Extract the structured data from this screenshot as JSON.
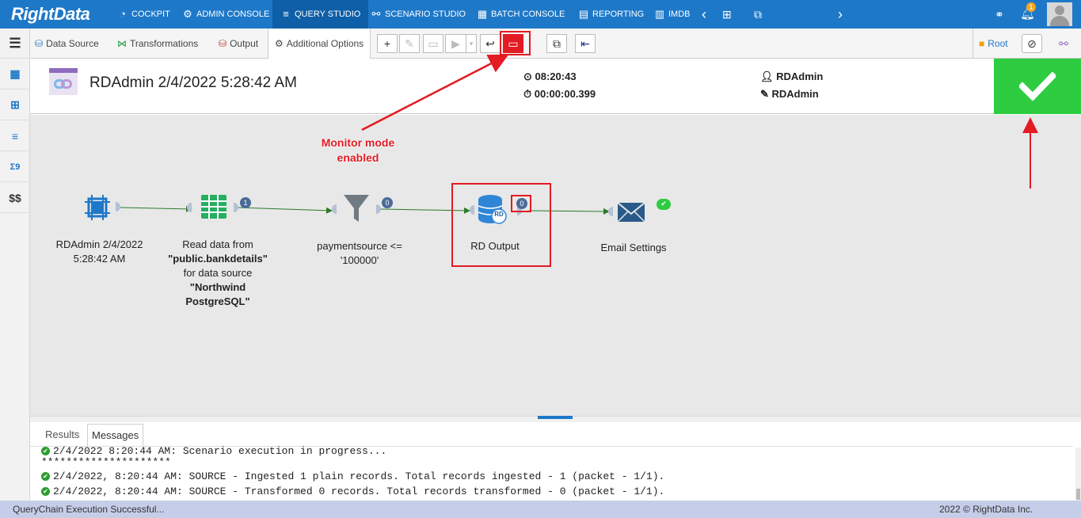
{
  "app": {
    "logo": "RightData"
  },
  "nav": {
    "items": [
      {
        "label": "COCKPIT",
        "icon": "cockpit-icon"
      },
      {
        "label": "ADMIN CONSOLE",
        "icon": "gear-icon"
      },
      {
        "label": "QUERY STUDIO",
        "icon": "database-icon"
      },
      {
        "label": "SCENARIO STUDIO",
        "icon": "scenario-icon"
      },
      {
        "label": "BATCH CONSOLE",
        "icon": "batch-icon"
      },
      {
        "label": "REPORTING",
        "icon": "report-icon"
      },
      {
        "label": "IMDB",
        "icon": "imdb-icon"
      }
    ],
    "active": "QUERY STUDIO",
    "notification_count": "1"
  },
  "toolbar": {
    "tabs": [
      {
        "label": "Data Source"
      },
      {
        "label": "Transformations"
      },
      {
        "label": "Output"
      },
      {
        "label": "Additional Options"
      }
    ],
    "root_label": "Root"
  },
  "header": {
    "title": "RDAdmin 2/4/2022 5:28:42 AM",
    "time": "08:20:43",
    "duration": "00:00:00.399",
    "user": "RDAdmin",
    "editor": "RDAdmin"
  },
  "canvas": {
    "nodes": [
      {
        "label_lines": [
          "RDAdmin 2/4/2022",
          "5:28:42 AM"
        ]
      },
      {
        "label_lines": [
          "Read data from",
          "\"public.bankdetails\"",
          "for data source",
          "\"Northwind",
          "PostgreSQL\""
        ],
        "badge": "1"
      },
      {
        "label_lines": [
          "paymentsource <=",
          "'100000'"
        ],
        "badge": "0"
      },
      {
        "label_lines": [
          "RD Output"
        ],
        "badge": "0",
        "icon_text": "RD"
      },
      {
        "label_lines": [
          "Email Settings"
        ]
      }
    ],
    "annotation": {
      "line1": "Monitor mode",
      "line2": "enabled"
    }
  },
  "results": {
    "tabs": [
      "Results",
      "Messages"
    ],
    "active_tab": "Messages",
    "messages": [
      {
        "text": "2/4/2022 8:20:44 AM: Scenario execution in progress...",
        "ok": true
      },
      {
        "text": "*********************",
        "ok": false
      },
      {
        "text": "2/4/2022, 8:20:44 AM: SOURCE - Ingested 1 plain records. Total records ingested - 1 (packet - 1/1).",
        "ok": true
      },
      {
        "text": "2/4/2022, 8:20:44 AM: SOURCE - Transformed 0 records. Total records transformed - 0 (packet - 1/1).",
        "ok": true
      }
    ]
  },
  "status": {
    "message": "QueryChain Execution Successful...",
    "copyright": "2022 © RightData Inc."
  },
  "colors": {
    "brand": "#1e78c8",
    "success": "#2ecc40",
    "annotation": "#e31b23"
  }
}
